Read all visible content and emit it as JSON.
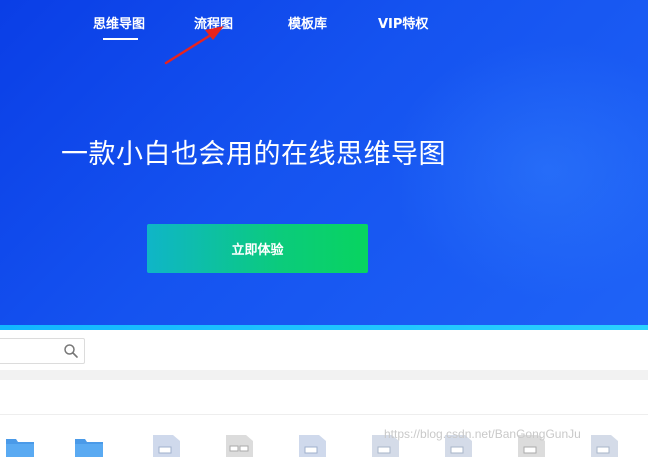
{
  "nav": {
    "items": [
      {
        "label": "思维导图",
        "active": true
      },
      {
        "label": "流程图",
        "active": false
      },
      {
        "label": "模板库",
        "active": false
      },
      {
        "label": "VIP特权",
        "active": false
      }
    ]
  },
  "hero": {
    "headline": "一款小白也会用的在线思维导图",
    "cta_label": "立即体验"
  },
  "annotation": {
    "arrow_color": "#e8231e"
  },
  "toolbar": {
    "search_placeholder": ""
  },
  "files": {
    "icons": [
      "folder-icon",
      "folder-icon",
      "document-icon",
      "document-icon",
      "document-icon",
      "document-icon",
      "document-icon",
      "document-icon",
      "document-icon"
    ]
  },
  "watermark": "https://blog.csdn.net/BanGongGunJu",
  "colors": {
    "hero_start": "#0a3ee6",
    "hero_end": "#1f63f7",
    "cta_start": "#0fb5c8",
    "cta_end": "#08d45f",
    "folder": "#4a9ae8"
  }
}
